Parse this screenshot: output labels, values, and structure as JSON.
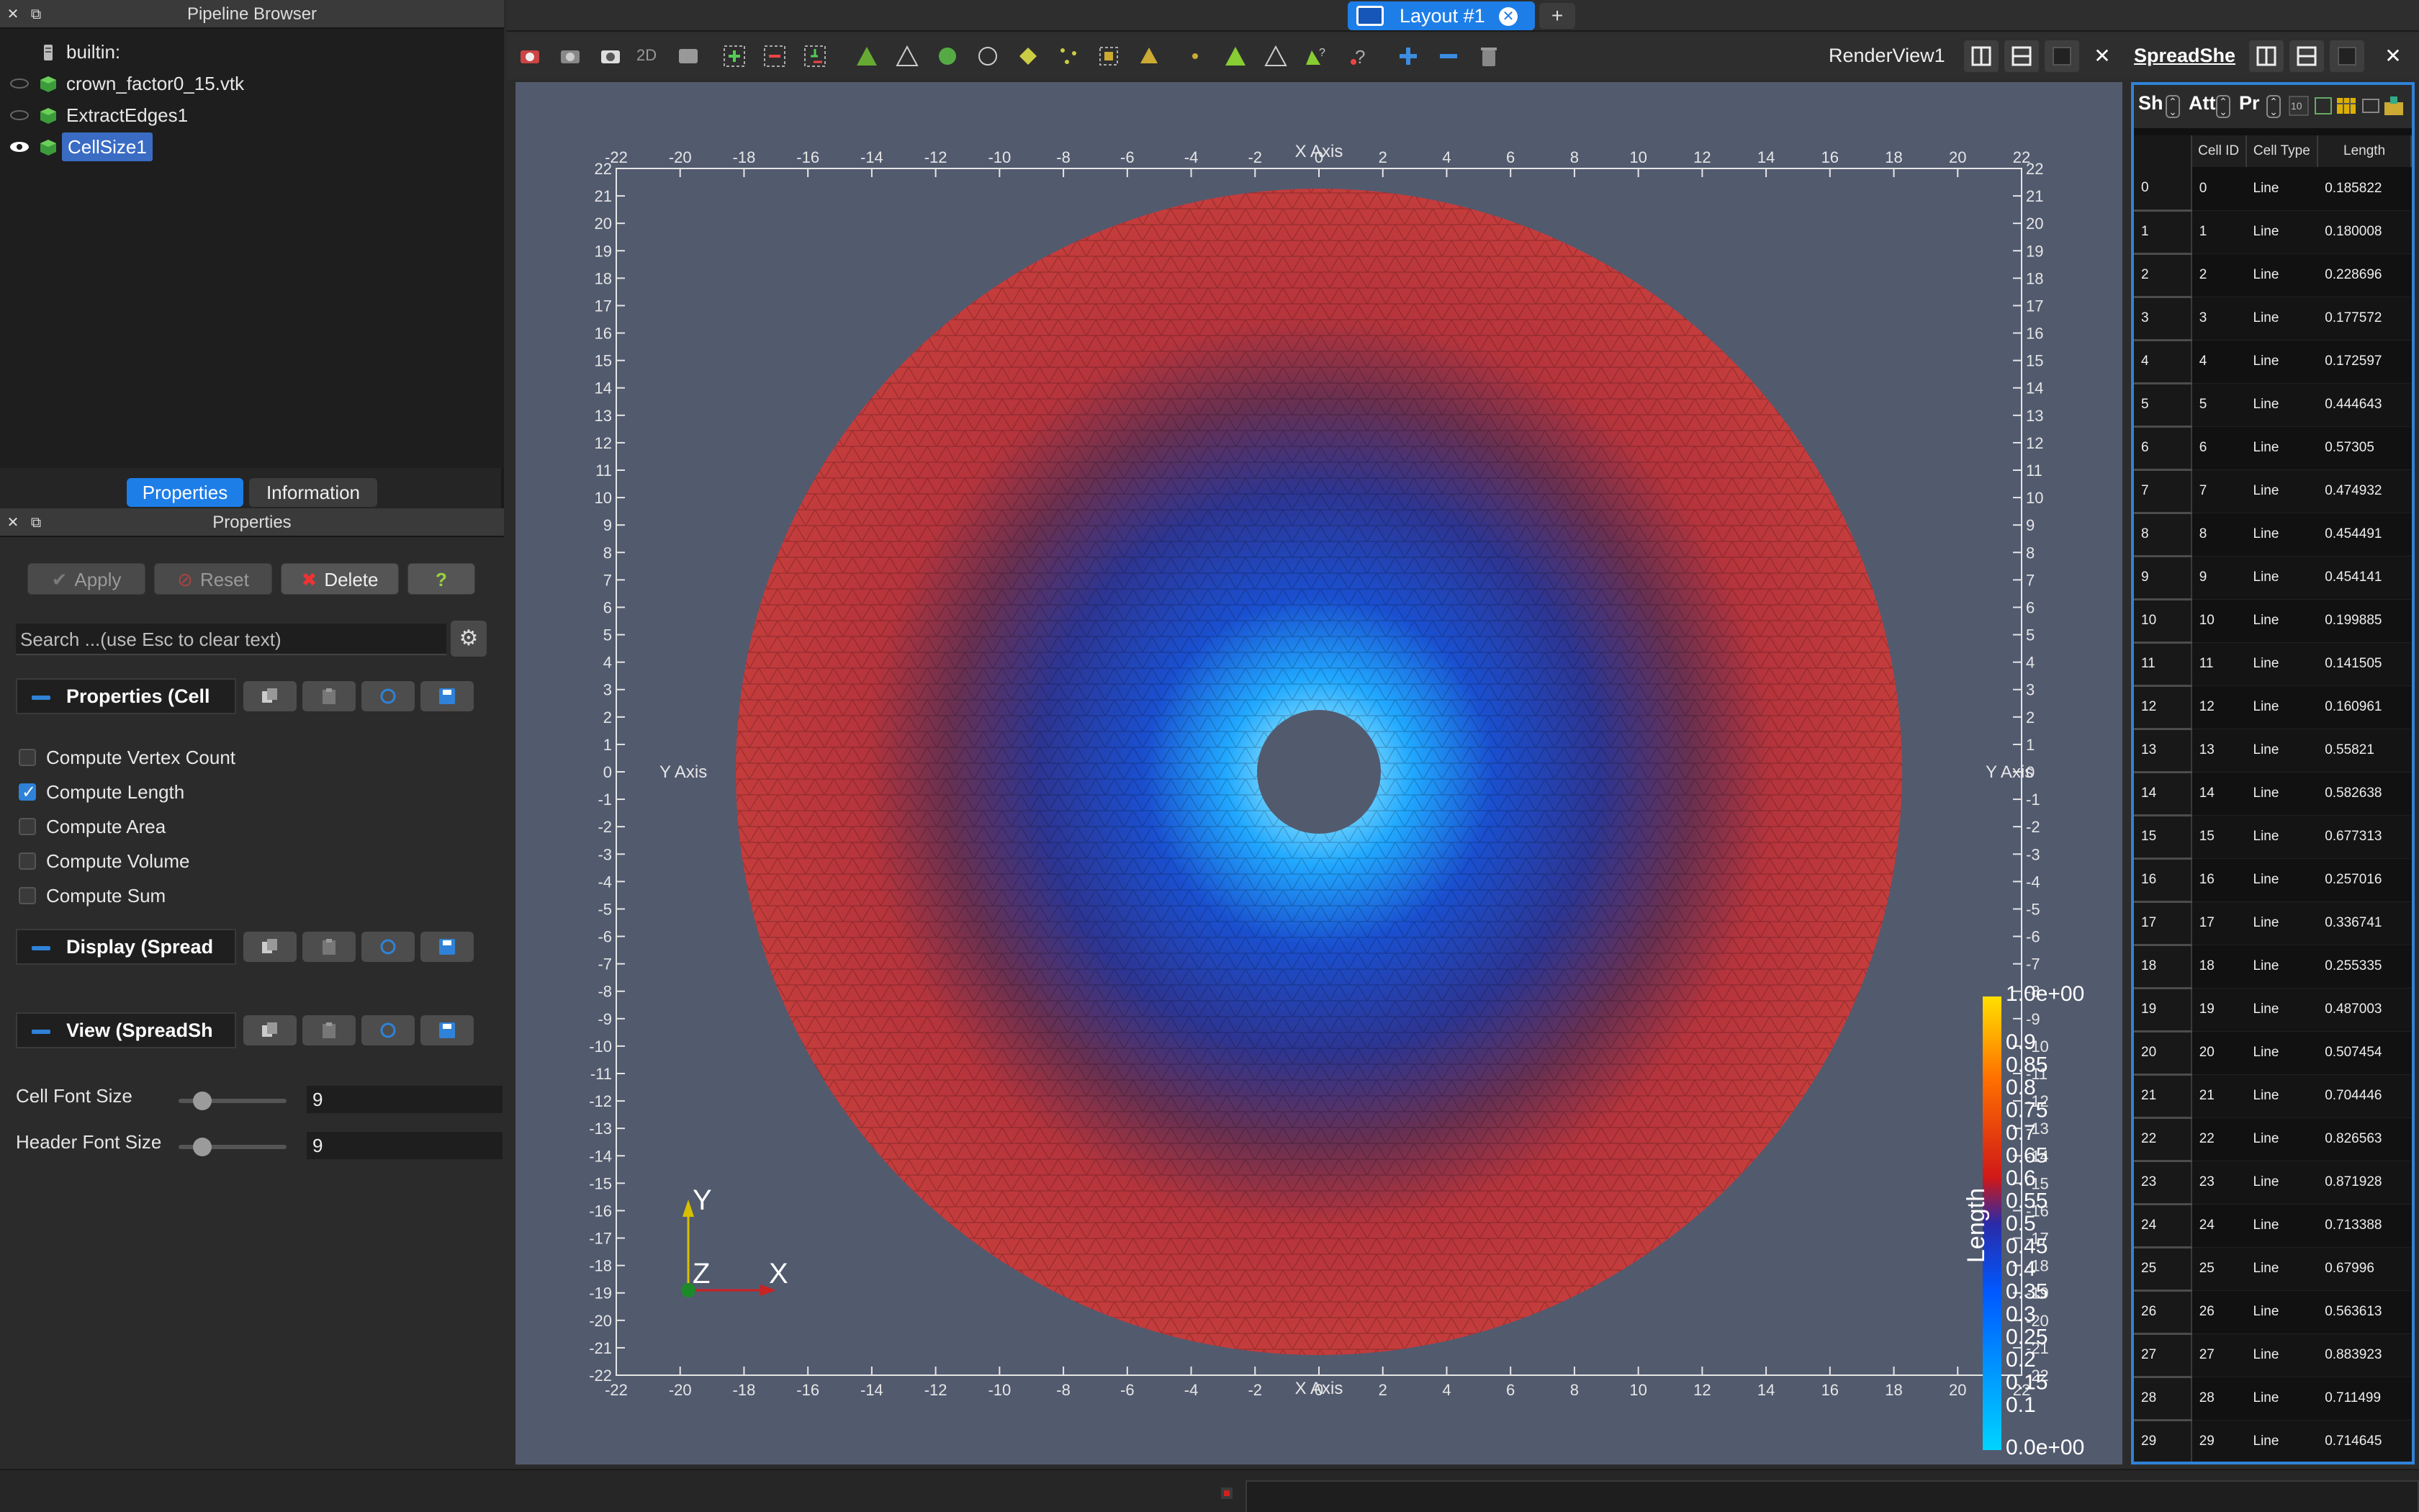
{
  "pipeline_browser": {
    "title": "Pipeline Browser",
    "items": [
      {
        "label": "builtin:",
        "visible": null,
        "selected": false
      },
      {
        "label": "crown_factor0_15.vtk",
        "visible": false,
        "selected": false
      },
      {
        "label": "ExtractEdges1",
        "visible": false,
        "selected": false
      },
      {
        "label": "CellSize1",
        "visible": true,
        "selected": true
      }
    ]
  },
  "tabs": {
    "properties": "Properties",
    "information": "Information",
    "active": "Properties"
  },
  "properties_panel": {
    "title": "Properties",
    "apply": "Apply",
    "reset": "Reset",
    "delete": "Delete",
    "help": "?",
    "search_placeholder": "Search ...(use Esc to clear text)",
    "sections": {
      "properties": "Properties (Cell",
      "display": "Display (Spread",
      "view": "View (SpreadSh"
    },
    "checkboxes": [
      {
        "label": "Compute Vertex Count",
        "checked": false
      },
      {
        "label": "Compute Length",
        "checked": true
      },
      {
        "label": "Compute Area",
        "checked": false
      },
      {
        "label": "Compute Volume",
        "checked": false
      },
      {
        "label": "Compute Sum",
        "checked": false
      }
    ],
    "cell_font_size": {
      "label": "Cell Font Size",
      "value": "9"
    },
    "header_font_size": {
      "label": "Header Font Size",
      "value": "9"
    }
  },
  "layout_tab": {
    "label": "Layout #1",
    "add": "+"
  },
  "render_view": {
    "title": "RenderView1",
    "toolbar_2d": "2D",
    "x_axis_label": "X Axis",
    "y_axis_label": "Y Axis",
    "x_ticks": [
      "-22",
      "-20",
      "-18",
      "-16",
      "-14",
      "-12",
      "-10",
      "-8",
      "-6",
      "-4",
      "-2",
      "0",
      "2",
      "4",
      "6",
      "8",
      "10",
      "12",
      "14",
      "16",
      "18",
      "20",
      "22"
    ],
    "y_ticks": [
      "22",
      "21",
      "20",
      "19",
      "18",
      "17",
      "16",
      "15",
      "14",
      "13",
      "12",
      "11",
      "10",
      "9",
      "8",
      "7",
      "6",
      "5",
      "4",
      "3",
      "2",
      "1",
      "0",
      "-1",
      "-2",
      "-3",
      "-4",
      "-5",
      "-6",
      "-7",
      "-8",
      "-9",
      "-10",
      "-11",
      "-12",
      "-13",
      "-14",
      "-15",
      "-16",
      "-17",
      "-18",
      "-19",
      "-20",
      "-21",
      "-22"
    ],
    "orientation": {
      "y": "Y",
      "z": "Z",
      "x": "X"
    },
    "colorbar": {
      "title": "Length",
      "max_label": "1.0e+00",
      "min_label": "0.0e+00",
      "ticks": [
        "0.9",
        "0.85",
        "0.8",
        "0.75",
        "0.7",
        "0.65",
        "0.6",
        "0.55",
        "0.5",
        "0.45",
        "0.4",
        "0.35",
        "0.3",
        "0.25",
        "0.2",
        "0.15",
        "0.1"
      ],
      "colors": [
        "#00d4ff",
        "#0058ff",
        "#2a2aa8",
        "#d01818",
        "#ff7000",
        "#ffe000"
      ]
    }
  },
  "spreadsheet": {
    "title": "SpreadShe",
    "controls": [
      "Sh",
      "Att",
      "Pr"
    ],
    "columns": [
      "Cell ID",
      "Cell Type",
      "Length"
    ],
    "rows": [
      [
        "0",
        "0",
        "Line",
        "0.185822"
      ],
      [
        "1",
        "1",
        "Line",
        "0.180008"
      ],
      [
        "2",
        "2",
        "Line",
        "0.228696"
      ],
      [
        "3",
        "3",
        "Line",
        "0.177572"
      ],
      [
        "4",
        "4",
        "Line",
        "0.172597"
      ],
      [
        "5",
        "5",
        "Line",
        "0.444643"
      ],
      [
        "6",
        "6",
        "Line",
        "0.57305"
      ],
      [
        "7",
        "7",
        "Line",
        "0.474932"
      ],
      [
        "8",
        "8",
        "Line",
        "0.454491"
      ],
      [
        "9",
        "9",
        "Line",
        "0.454141"
      ],
      [
        "10",
        "10",
        "Line",
        "0.199885"
      ],
      [
        "11",
        "11",
        "Line",
        "0.141505"
      ],
      [
        "12",
        "12",
        "Line",
        "0.160961"
      ],
      [
        "13",
        "13",
        "Line",
        "0.55821"
      ],
      [
        "14",
        "14",
        "Line",
        "0.582638"
      ],
      [
        "15",
        "15",
        "Line",
        "0.677313"
      ],
      [
        "16",
        "16",
        "Line",
        "0.257016"
      ],
      [
        "17",
        "17",
        "Line",
        "0.336741"
      ],
      [
        "18",
        "18",
        "Line",
        "0.255335"
      ],
      [
        "19",
        "19",
        "Line",
        "0.487003"
      ],
      [
        "20",
        "20",
        "Line",
        "0.507454"
      ],
      [
        "21",
        "21",
        "Line",
        "0.704446"
      ],
      [
        "22",
        "22",
        "Line",
        "0.826563"
      ],
      [
        "23",
        "23",
        "Line",
        "0.871928"
      ],
      [
        "24",
        "24",
        "Line",
        "0.713388"
      ],
      [
        "25",
        "25",
        "Line",
        "0.67996"
      ],
      [
        "26",
        "26",
        "Line",
        "0.563613"
      ],
      [
        "27",
        "27",
        "Line",
        "0.883923"
      ],
      [
        "28",
        "28",
        "Line",
        "0.711499"
      ],
      [
        "29",
        "29",
        "Line",
        "0.714645"
      ]
    ]
  },
  "colors": {
    "accent": "#2f82d8",
    "layout_tab": "#1d7ee8",
    "selection": "#3a6cc4",
    "render_bg": "#525a6e"
  }
}
